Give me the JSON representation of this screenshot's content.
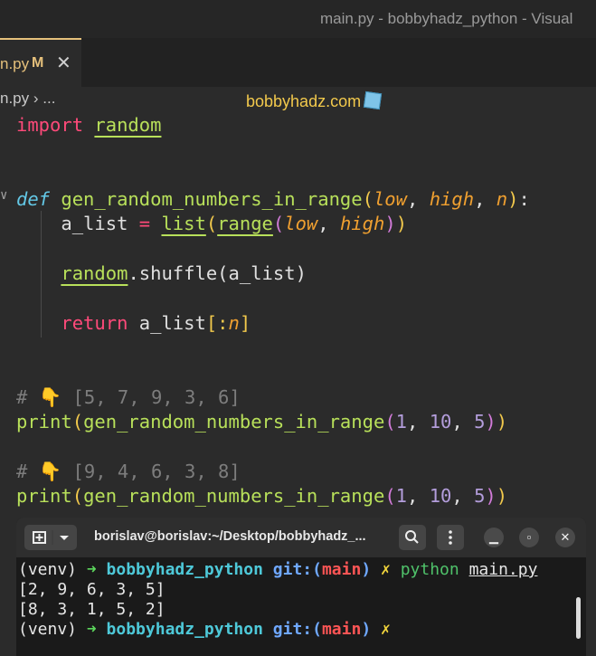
{
  "window": {
    "title": "main.py - bobbyhadz_python - Visual"
  },
  "tab": {
    "label": "n.py",
    "modified": "M",
    "close": "✕"
  },
  "banner": {
    "text": "bobbyhadz.com",
    "icon": "ice-cube-icon"
  },
  "breadcrumb": {
    "file": "n.py",
    "sep": "›",
    "more": "..."
  },
  "code": {
    "import_kw": "import",
    "import_mod": "random",
    "def_kw": "def",
    "func_name": "gen_random_numbers_in_range",
    "open_paren": "(",
    "param_low": "low",
    "comma1": ", ",
    "param_high": "high",
    "comma2": ", ",
    "param_n": "n",
    "close_paren": ")",
    "colon": ":",
    "line2_var": "a_list",
    "line2_eq": " = ",
    "line2_list": "list",
    "line2_range": "range",
    "line2_args_low": "low",
    "line2_args_high": "high",
    "line3_mod": "random",
    "line3_rest": ".shuffle(a_list)",
    "return_kw": "return",
    "return_val": " a_list",
    "return_slice_open": "[:",
    "return_n": "n",
    "return_slice_close": "]",
    "comment1_hash": "# ",
    "comment1_text": " [5, 7, 9, 3, 6]",
    "comment2_hash": "# ",
    "comment2_text": " [9, 4, 6, 3, 8]",
    "print_fn": "print",
    "call_name": "gen_random_numbers_in_range",
    "arg1": "1",
    "arg2": "10",
    "arg3": "5",
    "hand_emoji": "👇"
  },
  "terminal": {
    "title": "borislav@borislav:~/Desktop/bobbyhadz_...",
    "prompt_env": "(venv) ",
    "arrow": "➜",
    "dir": "bobbyhadz_python",
    "git_label": " git:(",
    "branch": "main",
    "git_close": ")",
    "dirty": "✗",
    "cmd_python": "python",
    "cmd_file": "main.py",
    "output1": "[2, 9, 6, 3, 5]",
    "output2": "[8, 3, 1, 5, 2]",
    "colors": {
      "bg": "#1a1a1a",
      "arrow": "#5cd65c",
      "dir": "#4ec9d9",
      "branch": "#ff5555"
    }
  },
  "theme": {
    "keyword": "#ff4a7a",
    "function": "#b8e05a",
    "def": "#63c8e6",
    "param": "#f0a030",
    "number": "#b39ddb",
    "comment": "#7d7d7d"
  }
}
